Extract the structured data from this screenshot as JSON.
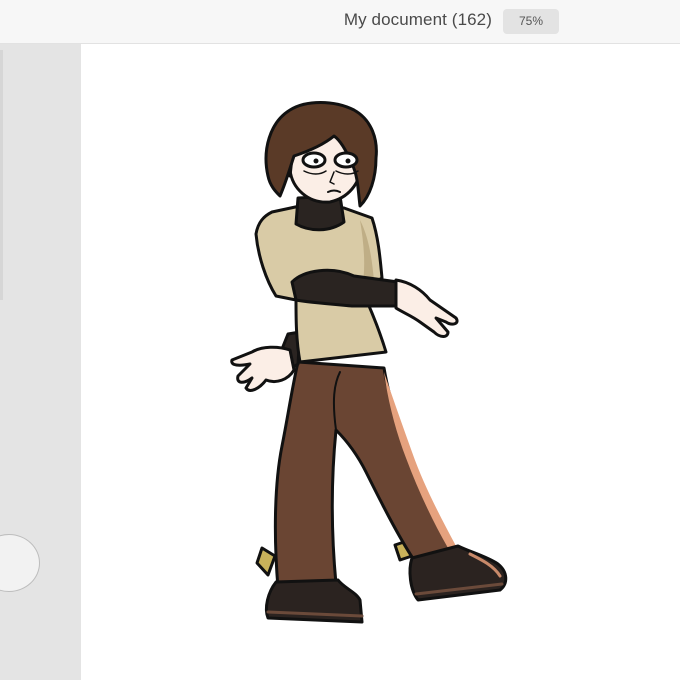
{
  "header": {
    "document_title": "My document (162)",
    "zoom_level": "75%"
  },
  "colors": {
    "topbar_bg": "#f7f7f7",
    "sidebar_bg": "#e4e4e4",
    "canvas_bg": "#ffffff",
    "hair": "#5a3a27",
    "skin": "#fbeee6",
    "shirt": "#d9cba6",
    "turtleneck": "#2a2421",
    "pants": "#6a4533",
    "boots": "#2b2320",
    "outline": "#111111"
  },
  "icons": {
    "side_handle": "circle-handle-icon"
  }
}
